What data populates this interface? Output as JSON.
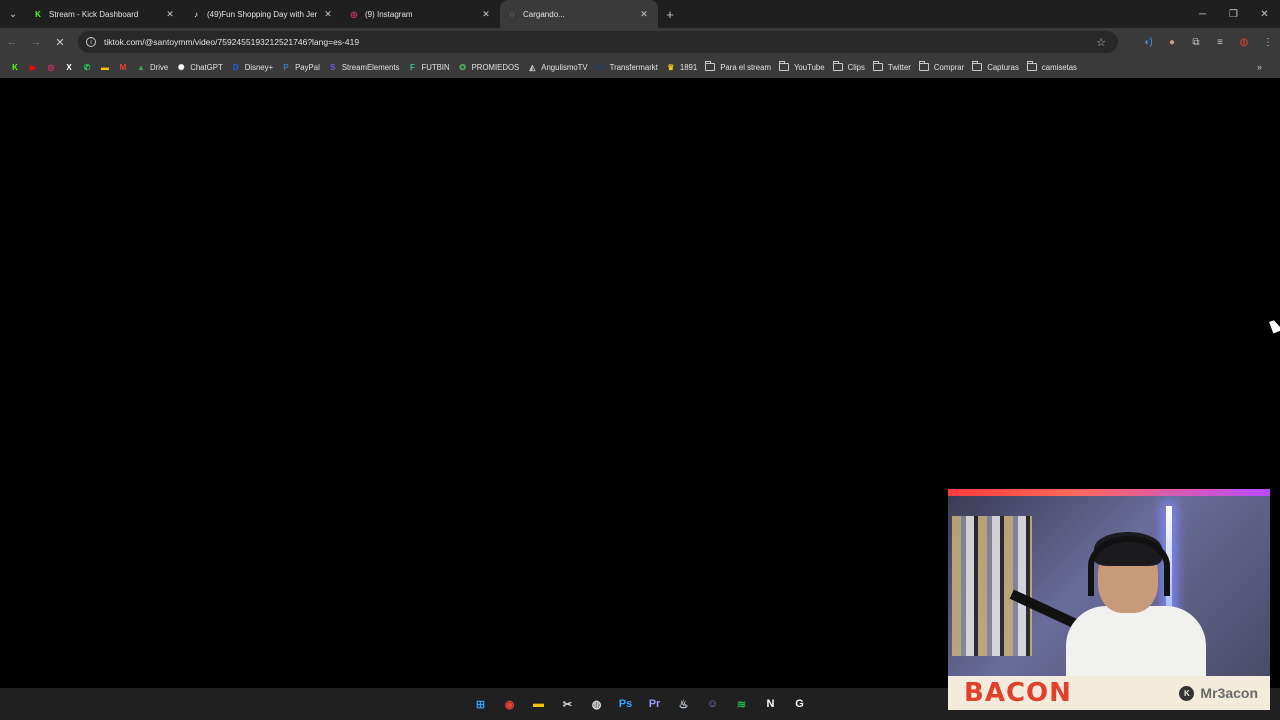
{
  "tabs": [
    {
      "title": "Stream - Kick Dashboard",
      "icon": "kick-icon",
      "color": "#53fc18",
      "glyph": "K"
    },
    {
      "title": "(49)Fun Shopping Day with Jer",
      "icon": "tiktok-icon",
      "color": "#ffffff",
      "glyph": "♪"
    },
    {
      "title": "(9) Instagram",
      "icon": "instagram-icon",
      "color": "#e1306c",
      "glyph": "◎"
    },
    {
      "title": "Cargando...",
      "icon": "loading-spinner-icon",
      "color": "#c8c8c8",
      "glyph": "◌"
    }
  ],
  "address": {
    "url": "tiktok.com/@santoymm/video/7592455193212521746?lang=es-419"
  },
  "bookmarks": [
    {
      "label": "",
      "icon": "kick-icon",
      "color": "#53fc18",
      "glyph": "K"
    },
    {
      "label": "",
      "icon": "youtube-icon",
      "color": "#ff0000",
      "glyph": "▶"
    },
    {
      "label": "",
      "icon": "instagram-icon",
      "color": "#e1306c",
      "glyph": "◎"
    },
    {
      "label": "",
      "icon": "x-icon",
      "color": "#ffffff",
      "glyph": "X"
    },
    {
      "label": "",
      "icon": "whatsapp-icon",
      "color": "#25d366",
      "glyph": "✆"
    },
    {
      "label": "",
      "icon": "bookmark-yellow-icon",
      "color": "#f4c20d",
      "glyph": "▬"
    },
    {
      "label": "",
      "icon": "gmail-icon",
      "color": "#ea4335",
      "glyph": "M"
    },
    {
      "label": "Drive",
      "icon": "drive-icon",
      "color": "#34a853",
      "glyph": "▲"
    },
    {
      "label": "ChatGPT",
      "icon": "chatgpt-icon",
      "color": "#ffffff",
      "glyph": "✺"
    },
    {
      "label": "Disney+",
      "icon": "disney-icon",
      "color": "#1f5fe0",
      "glyph": "D"
    },
    {
      "label": "PayPal",
      "icon": "paypal-icon",
      "color": "#3b7bbf",
      "glyph": "P"
    },
    {
      "label": "StreamElements",
      "icon": "streamelements-icon",
      "color": "#6e59f5",
      "glyph": "S"
    },
    {
      "label": "FUTBIN",
      "icon": "futbin-icon",
      "color": "#38c3a0",
      "glyph": "F"
    },
    {
      "label": "PROMIEDOS",
      "icon": "promiedos-icon",
      "color": "#4caf50",
      "glyph": "✪"
    },
    {
      "label": "AngulismoTV",
      "icon": "angulismo-icon",
      "color": "#c8c8c8",
      "glyph": "◭"
    },
    {
      "label": "Transfermarkt",
      "icon": "transfermarkt-icon",
      "color": "#1a3d6b",
      "glyph": "tm"
    },
    {
      "label": "1891",
      "icon": "trophy-icon",
      "color": "#f4c20d",
      "glyph": "♛"
    },
    {
      "label": "Para el stream",
      "icon": "folder-icon",
      "folder": true
    },
    {
      "label": "YouTube",
      "icon": "folder-icon",
      "folder": true
    },
    {
      "label": "Clips",
      "icon": "folder-icon",
      "folder": true
    },
    {
      "label": "Twitter",
      "icon": "folder-icon",
      "folder": true
    },
    {
      "label": "Comprar",
      "icon": "folder-icon",
      "folder": true
    },
    {
      "label": "Capturas",
      "icon": "folder-icon",
      "folder": true
    },
    {
      "label": "camisetas",
      "icon": "folder-icon",
      "folder": true
    }
  ],
  "webcam": {
    "brand": "BACON",
    "handle": "Mr3acon"
  },
  "taskbar_apps": [
    {
      "icon": "windows-start-icon",
      "color": "#3c9bf0",
      "glyph": "⊞"
    },
    {
      "icon": "chrome-icon",
      "color": "#e94235",
      "glyph": "◉"
    },
    {
      "icon": "file-explorer-icon",
      "color": "#f4c20d",
      "glyph": "▬"
    },
    {
      "icon": "snipping-tool-icon",
      "color": "#dcdcdc",
      "glyph": "✂"
    },
    {
      "icon": "obs-icon",
      "color": "#dcdcdc",
      "glyph": "◍"
    },
    {
      "icon": "photoshop-icon",
      "color": "#31a8ff",
      "glyph": "Ps"
    },
    {
      "icon": "premiere-icon",
      "color": "#9999ff",
      "glyph": "Pr"
    },
    {
      "icon": "steam-icon",
      "color": "#c7d5e0",
      "glyph": "♨"
    },
    {
      "icon": "discord-icon",
      "color": "#7289da",
      "glyph": "☺"
    },
    {
      "icon": "spotify-icon",
      "color": "#1db954",
      "glyph": "≋"
    },
    {
      "icon": "notion-icon",
      "color": "#ffffff",
      "glyph": "N"
    },
    {
      "icon": "logitech-icon",
      "color": "#ffffff",
      "glyph": "G"
    }
  ]
}
